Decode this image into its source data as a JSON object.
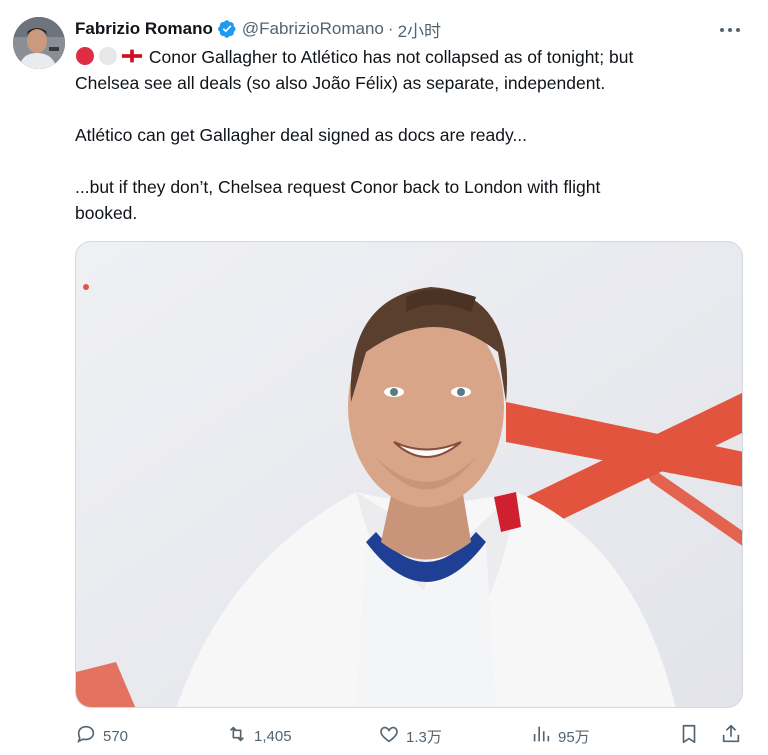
{
  "author": {
    "name": "Fabrizio Romano",
    "handle": "@FabrizioRomano",
    "separator": "·",
    "time": "2小时"
  },
  "tweet": {
    "line1": "Conor Gallagher to Atlético has not collapsed as of tonight; but",
    "line2": "Chelsea see all deals (so also João Félix) as separate, independent.",
    "para2": "Atlético can get Gallagher deal signed as docs are ready...",
    "para3_line1": "...but if they don’t, Chelsea request Conor back to London with flight",
    "para3_line2": "booked."
  },
  "stats": {
    "replies": "570",
    "retweets": "1,405",
    "likes": "1.3万",
    "views": "95万"
  },
  "colors": {
    "text": "#0f1419",
    "secondary": "#536471",
    "verified": "#1d9bf0",
    "accent_red": "#e2543d"
  },
  "icons": {
    "verified": "verified-badge-icon",
    "more": "more-dots-icon",
    "reply": "reply-icon",
    "retweet": "retweet-icon",
    "like": "heart-icon",
    "views": "views-icon",
    "bookmark": "bookmark-icon",
    "share": "share-icon"
  }
}
